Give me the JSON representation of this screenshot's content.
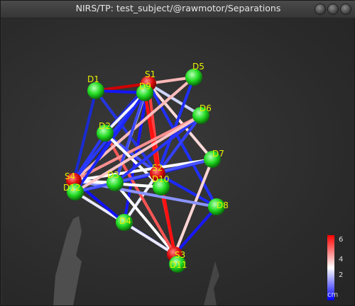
{
  "window": {
    "title": "NIRS/TP: test_subject/@rawmotor/Separations"
  },
  "optodes": [
    {
      "id": "S1",
      "type": "source"
    },
    {
      "id": "S2",
      "type": "source"
    },
    {
      "id": "S3",
      "type": "source"
    },
    {
      "id": "S4",
      "type": "source"
    },
    {
      "id": "D1",
      "type": "detector"
    },
    {
      "id": "D2",
      "type": "detector"
    },
    {
      "id": "D3",
      "type": "detector"
    },
    {
      "id": "D4",
      "type": "detector"
    },
    {
      "id": "D5",
      "type": "detector"
    },
    {
      "id": "D6",
      "type": "detector"
    },
    {
      "id": "D7",
      "type": "detector"
    },
    {
      "id": "D8",
      "type": "detector"
    },
    {
      "id": "D9",
      "type": "detector"
    },
    {
      "id": "D10",
      "type": "detector"
    },
    {
      "id": "D11",
      "type": "detector"
    },
    {
      "id": "D12",
      "type": "detector"
    }
  ],
  "colorbar": {
    "ticks": [
      "6",
      "4",
      "2"
    ],
    "unit": "cm",
    "colors": {
      "high": "#ff0000",
      "mid": "#ffffff",
      "low": "#0000ff"
    }
  },
  "colors": {
    "source": "#e01010",
    "detector": "#22dd22",
    "label": "#e8f000",
    "background": "#2c2c2c"
  }
}
